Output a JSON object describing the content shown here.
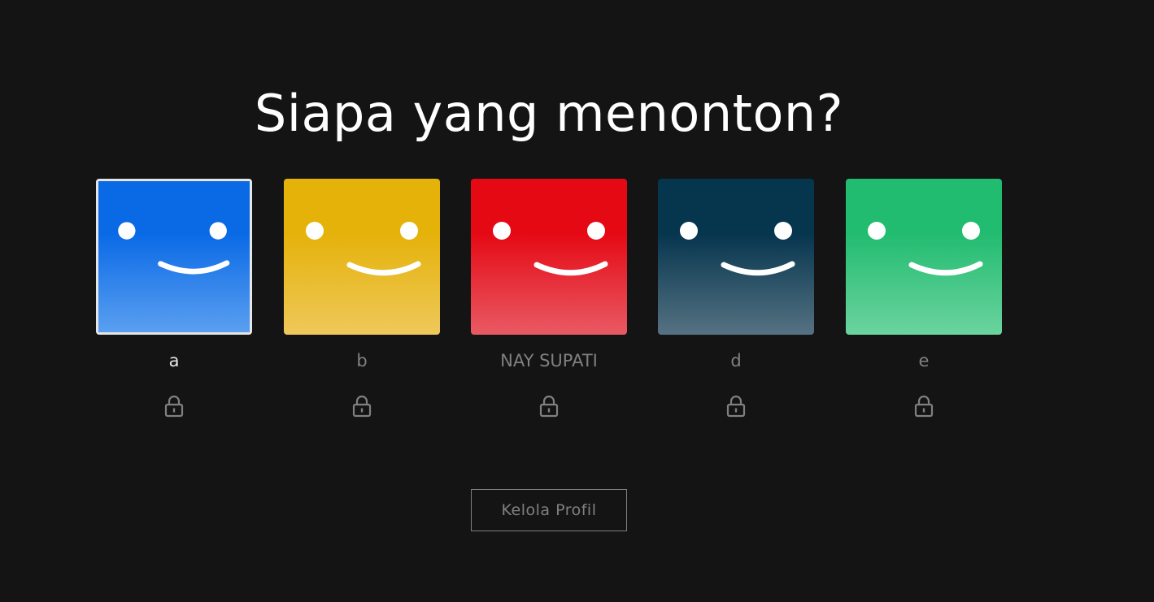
{
  "header": {
    "title": "Siapa yang menonton?"
  },
  "profiles": [
    {
      "name": "a",
      "color_top": "#0a6ae6",
      "color_bottom": "#5a9ff0",
      "selected": true,
      "locked": true,
      "icon": "smiley-avatar"
    },
    {
      "name": "b",
      "color_top": "#e5b20a",
      "color_bottom": "#eec85a",
      "selected": false,
      "locked": true,
      "icon": "smiley-avatar"
    },
    {
      "name": "NAY SUPATI",
      "color_top": "#e50914",
      "color_bottom": "#e85a64",
      "selected": false,
      "locked": true,
      "icon": "smiley-avatar"
    },
    {
      "name": "d",
      "color_top": "#06354e",
      "color_bottom": "#557282",
      "selected": false,
      "locked": true,
      "icon": "smiley-avatar"
    },
    {
      "name": "e",
      "color_top": "#22bc70",
      "color_bottom": "#6bd39f",
      "selected": false,
      "locked": true,
      "icon": "smiley-avatar"
    }
  ],
  "footer": {
    "manage_label": "Kelola Profil"
  },
  "colors": {
    "background": "#141414",
    "text_muted": "#808080",
    "text_active": "#e5e5e5"
  }
}
